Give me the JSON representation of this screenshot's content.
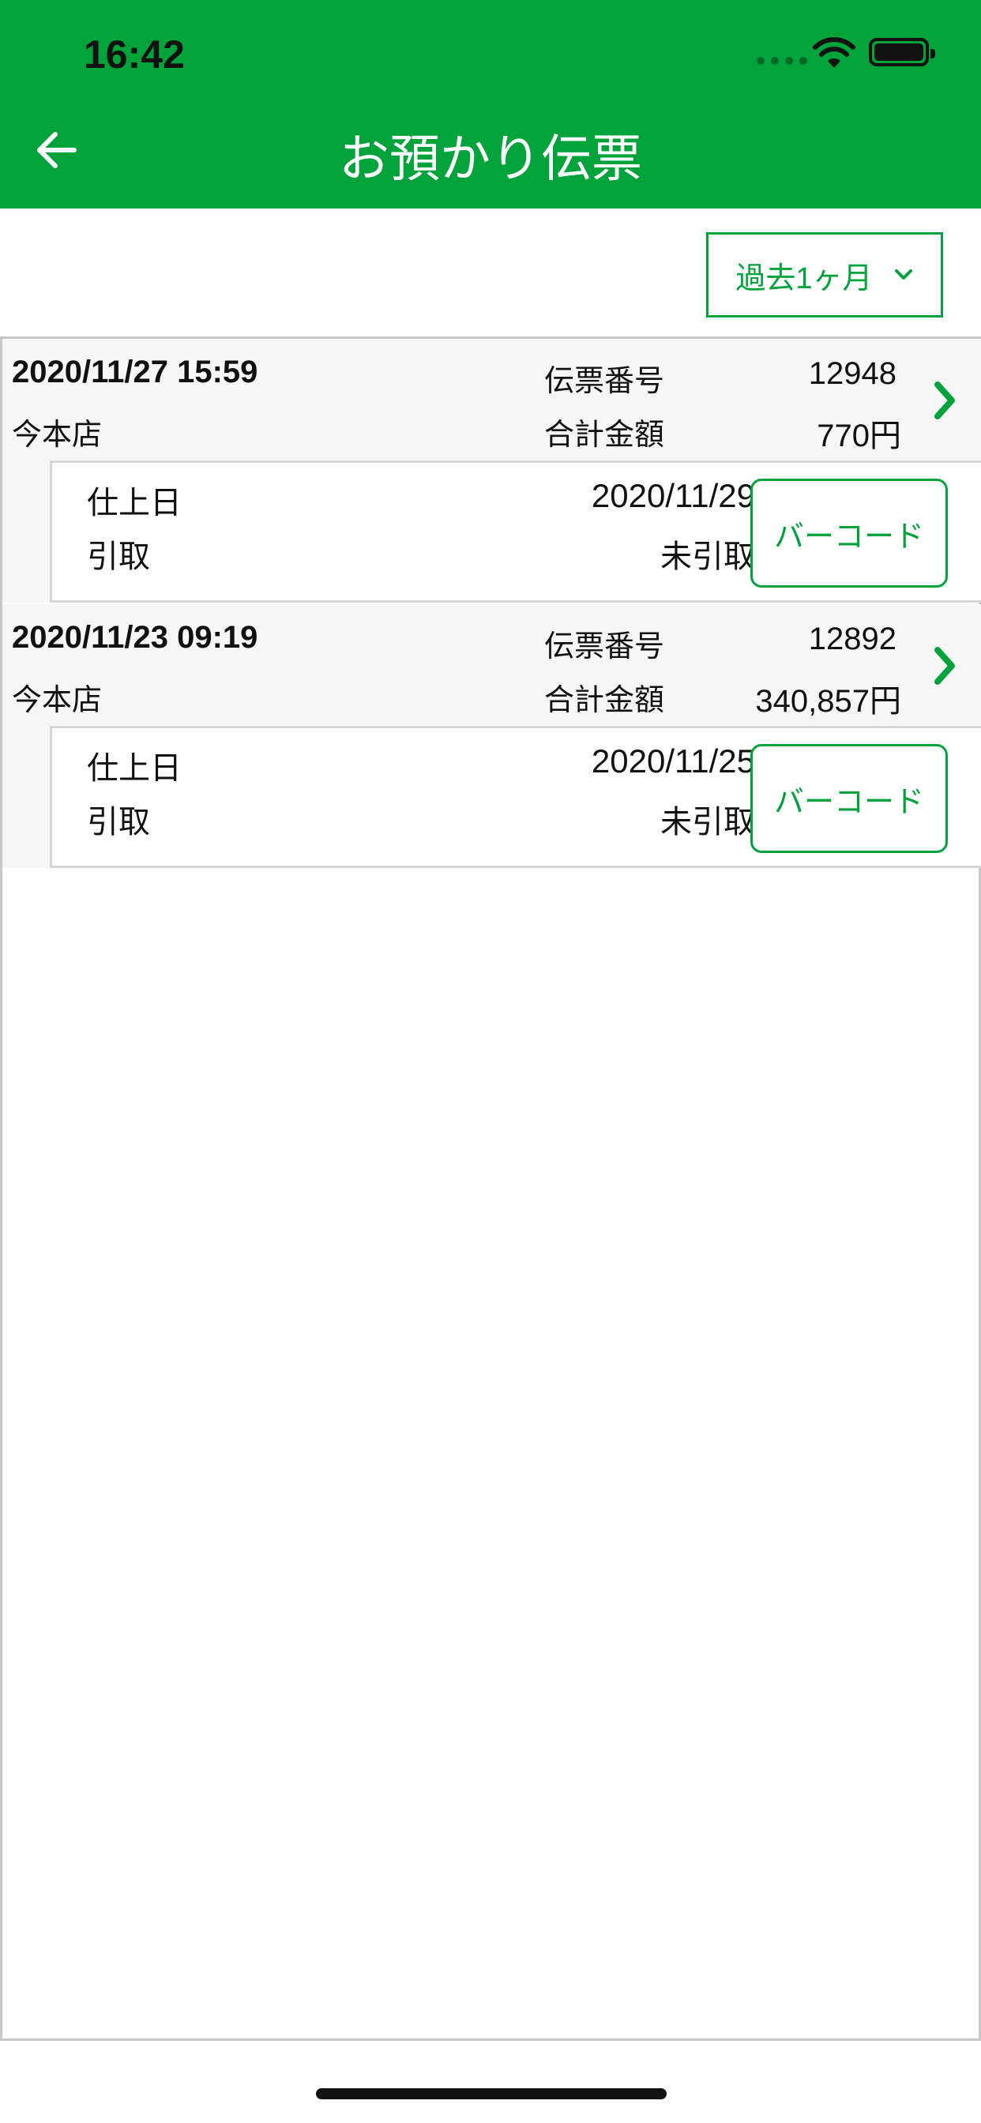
{
  "status_bar": {
    "time": "16:42"
  },
  "header": {
    "title": "お預かり伝票"
  },
  "filter": {
    "label": "過去1ヶ月"
  },
  "slips": [
    {
      "datetime": "2020/11/27 15:59",
      "store": "今本店",
      "slip_no_label": "伝票番号",
      "slip_no": "12948",
      "total_label": "合計金額",
      "total": "770円",
      "finish_label": "仕上日",
      "finish_date": "2020/11/29",
      "pickup_label": "引取",
      "pickup_status": "未引取",
      "barcode_label": "バーコード"
    },
    {
      "datetime": "2020/11/23 09:19",
      "store": "今本店",
      "slip_no_label": "伝票番号",
      "slip_no": "12892",
      "total_label": "合計金額",
      "total": "340,857円",
      "finish_label": "仕上日",
      "finish_date": "2020/11/25",
      "pickup_label": "引取",
      "pickup_status": "未引取",
      "barcode_label": "バーコード"
    }
  ],
  "colors": {
    "accent": "#03a33c",
    "row_bg": "#f6f6f6",
    "border": "#c8c8c8"
  },
  "icons": {
    "back": "arrow-left-icon",
    "chevron_right": "chevron-right-icon",
    "chevron_down": "chevron-down-icon"
  }
}
